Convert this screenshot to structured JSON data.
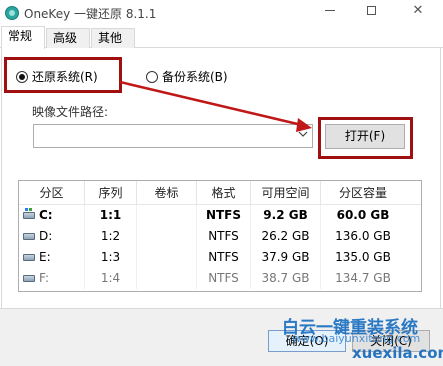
{
  "window": {
    "title": "OneKey 一键还原 8.1.1",
    "min_glyph": "",
    "close_glyph": "✕"
  },
  "tabs": [
    {
      "label": "常规",
      "active": true
    },
    {
      "label": "高级",
      "active": false
    },
    {
      "label": "其他",
      "active": false
    }
  ],
  "mode": {
    "restore_label": "还原系统(R)",
    "backup_label": "备份系统(B)",
    "selected": "restore"
  },
  "image_path": {
    "label": "映像文件路径:",
    "value": "",
    "open_button": "打开(F)"
  },
  "partition_table": {
    "columns": [
      "分区",
      "序列",
      "卷标",
      "格式",
      "可用空间",
      "分区容量"
    ],
    "rows": [
      {
        "partition": "C:",
        "sequence": "1:1",
        "volume": "",
        "format": "NTFS",
        "free": "9.2 GB",
        "capacity": "60.0 GB",
        "selected": true
      },
      {
        "partition": "D:",
        "sequence": "1:2",
        "volume": "",
        "format": "NTFS",
        "free": "26.2 GB",
        "capacity": "136.0 GB",
        "selected": false
      },
      {
        "partition": "E:",
        "sequence": "1:3",
        "volume": "",
        "format": "NTFS",
        "free": "37.9 GB",
        "capacity": "135.0 GB",
        "selected": false
      },
      {
        "partition": "F:",
        "sequence": "1:4",
        "volume": "",
        "format": "NTFS",
        "free": "38.7 GB",
        "capacity": "134.7 GB",
        "selected": false
      }
    ]
  },
  "footer": {
    "ok_button": "确定(O)",
    "cancel_button": "关闭(C)"
  },
  "watermark": {
    "brand": "白云一键重装系统",
    "url": "www.baiyunxitong.com",
    "site": "xuexila.com"
  },
  "colors": {
    "highlight_red": "#a01010",
    "watermark_blue": "#1a6fc1"
  },
  "icons": {
    "app": "onekey-app-icon",
    "drive": "hard-drive-icon",
    "combo": "chevron-down-icon"
  }
}
